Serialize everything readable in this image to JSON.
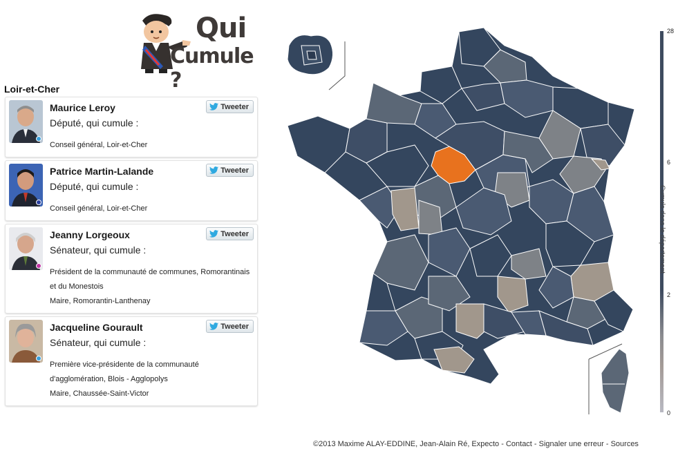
{
  "logo": {
    "line1": "Qui",
    "line2": "Cumule ?"
  },
  "department": {
    "name": "Loir-et-Cher"
  },
  "tweet_label": "Tweeter",
  "people": [
    {
      "name": "Maurice Leroy",
      "role": "Député, qui cumule :",
      "mandates": [
        "Conseil général, Loir-et-Cher"
      ],
      "dot_color": "#3aa0de"
    },
    {
      "name": "Patrice Martin-Lalande",
      "role": "Député, qui cumule :",
      "mandates": [
        "Conseil général, Loir-et-Cher"
      ],
      "dot_color": "#2a3f9f"
    },
    {
      "name": "Jeanny Lorgeoux",
      "role": "Sénateur, qui cumule :",
      "mandates": [
        "Président de la communauté de communes, Romorantinais et du Monestois",
        "Maire, Romorantin-Lanthenay"
      ],
      "dot_color": "#c033a3"
    },
    {
      "name": "Jacqueline Gourault",
      "role": "Sénateur, qui cumule :",
      "mandates": [
        "Première vice-présidente de la communauté d'agglomération, Blois - Agglopolys",
        "Maire, Chaussée-Saint-Victor"
      ],
      "dot_color": "#3aa0de"
    }
  ],
  "legend": {
    "axis_label": "Cumuls dans le département",
    "ticks": [
      "28",
      "6",
      "2",
      "0"
    ]
  },
  "colors": {
    "highlight": "#e8721e",
    "dark": "#34465e",
    "mid": "#5b6776",
    "gray": "#7e8287",
    "tan": "#a1978c"
  },
  "footer": {
    "text": "©2013 Maxime ALAY-EDDINE, Jean-Alain Ré, Expecto - Contact - Signaler une erreur - Sources"
  }
}
